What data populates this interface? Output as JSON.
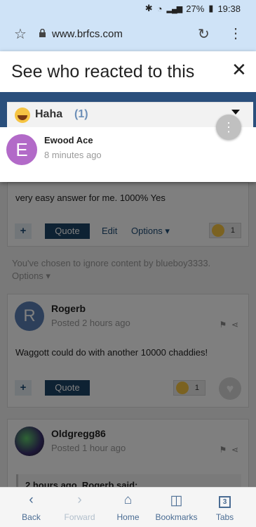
{
  "status_bar": {
    "battery": "27%",
    "time": "19:38",
    "bt_icon": "bluetooth-icon",
    "wifi_icon": "wifi-icon",
    "signal_icon": "signal-icon"
  },
  "browser": {
    "url": "www.brfcs.com"
  },
  "page": {
    "post1": {
      "text": "very easy answer for me. 1000% Yes",
      "quote": "Quote",
      "edit": "Edit",
      "options": "Options ▾",
      "reaction_count": "1"
    },
    "ignored": {
      "text": "You've chosen to ignore content by blueboy3333.",
      "options": "Options ▾"
    },
    "post2": {
      "avatar_letter": "R",
      "author": "Rogerb",
      "posted": "Posted 2 hours ago",
      "text": "Waggott could do with another 10000 chaddies!",
      "quote": "Quote",
      "reaction_count": "1"
    },
    "post3": {
      "author": "Oldgregg86",
      "posted": "Posted 1 hour ago",
      "quote_header": "2 hours ago, Rogerb said:"
    }
  },
  "modal": {
    "title": "See who reacted to this",
    "close_glyph": "✕",
    "reaction_tab": {
      "label": "Haha",
      "count": "(1)"
    },
    "users": [
      {
        "avatar_letter": "E",
        "avatar_color": "#b26ac8",
        "name": "Ewood Ace",
        "time": "8 minutes ago"
      }
    ]
  },
  "bottom_nav": [
    {
      "label": "Back",
      "icon": "back-icon"
    },
    {
      "label": "Forward",
      "icon": "forward-icon"
    },
    {
      "label": "Home",
      "icon": "home-icon"
    },
    {
      "label": "Bookmarks",
      "icon": "bookmarks-icon"
    },
    {
      "label": "Tabs",
      "icon": "tabs-icon",
      "count": "3"
    }
  ]
}
